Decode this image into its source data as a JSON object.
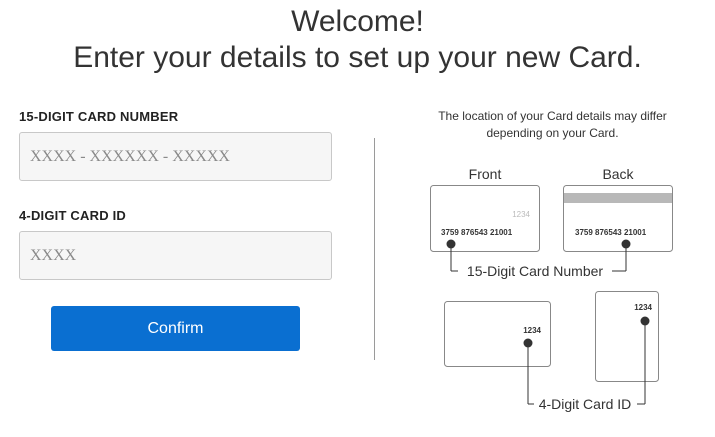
{
  "header": {
    "line1": "Welcome!",
    "line2": "Enter your details to set up your new Card."
  },
  "form": {
    "card_number_label": "15-DIGIT CARD NUMBER",
    "card_number_placeholder": "XXXX - XXXXXX - XXXXX",
    "card_number_value": "",
    "card_id_label": "4-DIGIT CARD ID",
    "card_id_placeholder": "XXXX",
    "card_id_value": "",
    "confirm_label": "Confirm"
  },
  "help": {
    "note": "The location of your Card details may differ depending on your Card.",
    "front_label": "Front",
    "back_label": "Back",
    "card_number_sample": "3759 876543 21001",
    "card_id_sample": "1234",
    "number_caption": "15-Digit Card Number",
    "id_caption": "4-Digit Card ID"
  },
  "colors": {
    "primary": "#0a6fd1",
    "field_bg": "#f6f6f6",
    "text": "#333333"
  }
}
